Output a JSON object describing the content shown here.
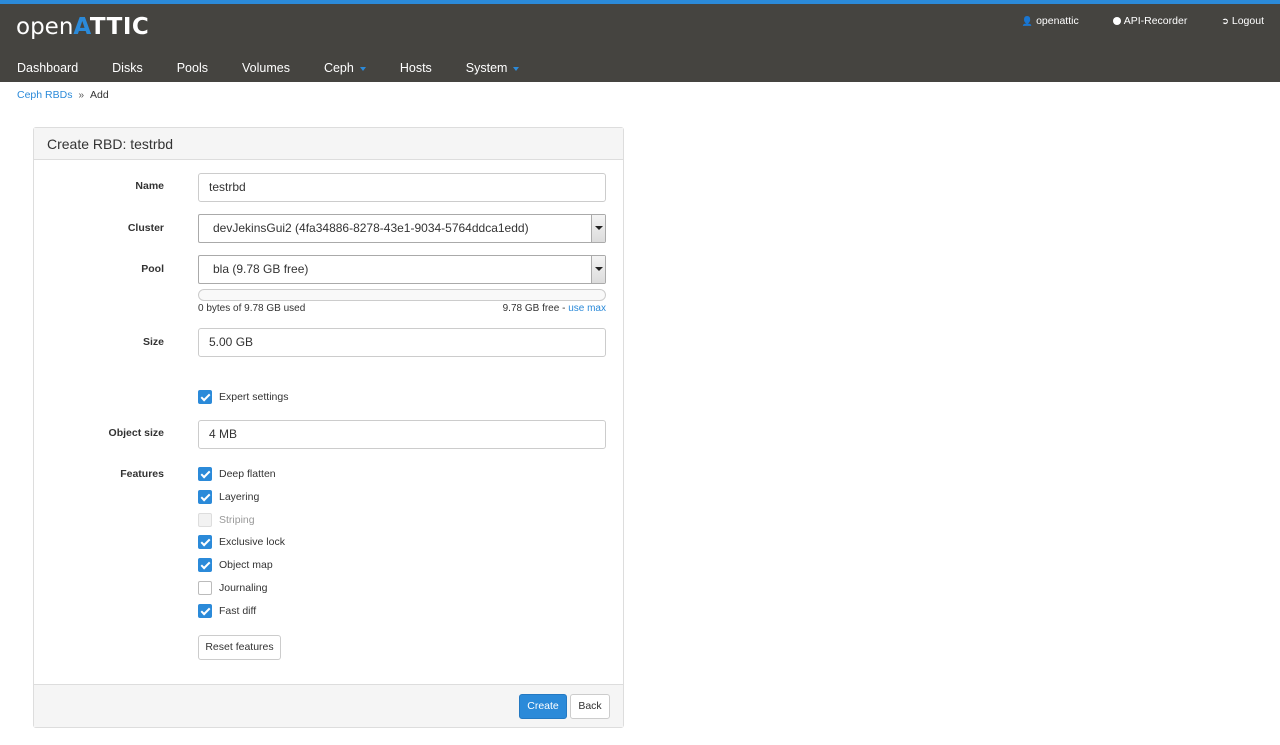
{
  "app": {
    "logo_open": "open",
    "logo_attic_a": "A",
    "logo_attic_rest": "TTIC"
  },
  "util_links": {
    "user": "openattic",
    "recorder": "API-Recorder",
    "logout": "Logout"
  },
  "nav": {
    "items": [
      "Dashboard",
      "Disks",
      "Pools",
      "Volumes",
      "Ceph",
      "Hosts",
      "System"
    ]
  },
  "breadcrumb": {
    "parent": "Ceph RBDs",
    "separator": "»",
    "current": "Add"
  },
  "form": {
    "title": "Create RBD: testrbd",
    "name_label": "Name",
    "name_value": "testrbd",
    "cluster_label": "Cluster",
    "cluster_value": "devJekinsGui2 (4fa34886-8278-43e1-9034-5764ddca1edd)",
    "pool_label": "Pool",
    "pool_value": "bla (9.78 GB free)",
    "pool_usage_fraction": 0.0,
    "usage_used": "0 bytes of 9.78 GB used",
    "usage_free": "9.78 GB free -",
    "use_max": "use max",
    "size_label": "Size",
    "size_value": "5.00 GB",
    "expert_label": "Expert settings",
    "expert_checked": true,
    "object_size_label": "Object size",
    "object_size_value": "4 MB",
    "features_label": "Features",
    "features": [
      {
        "label": "Deep flatten",
        "state": "checked"
      },
      {
        "label": "Layering",
        "state": "checked"
      },
      {
        "label": "Striping",
        "state": "disabled"
      },
      {
        "label": "Exclusive lock",
        "state": "checked"
      },
      {
        "label": "Object map",
        "state": "checked"
      },
      {
        "label": "Journaling",
        "state": "unchecked"
      },
      {
        "label": "Fast diff",
        "state": "checked"
      }
    ],
    "reset_features": "Reset features",
    "create": "Create",
    "back": "Back"
  },
  "colors": {
    "accent": "#2b8ad9",
    "header_bg": "#454440"
  }
}
